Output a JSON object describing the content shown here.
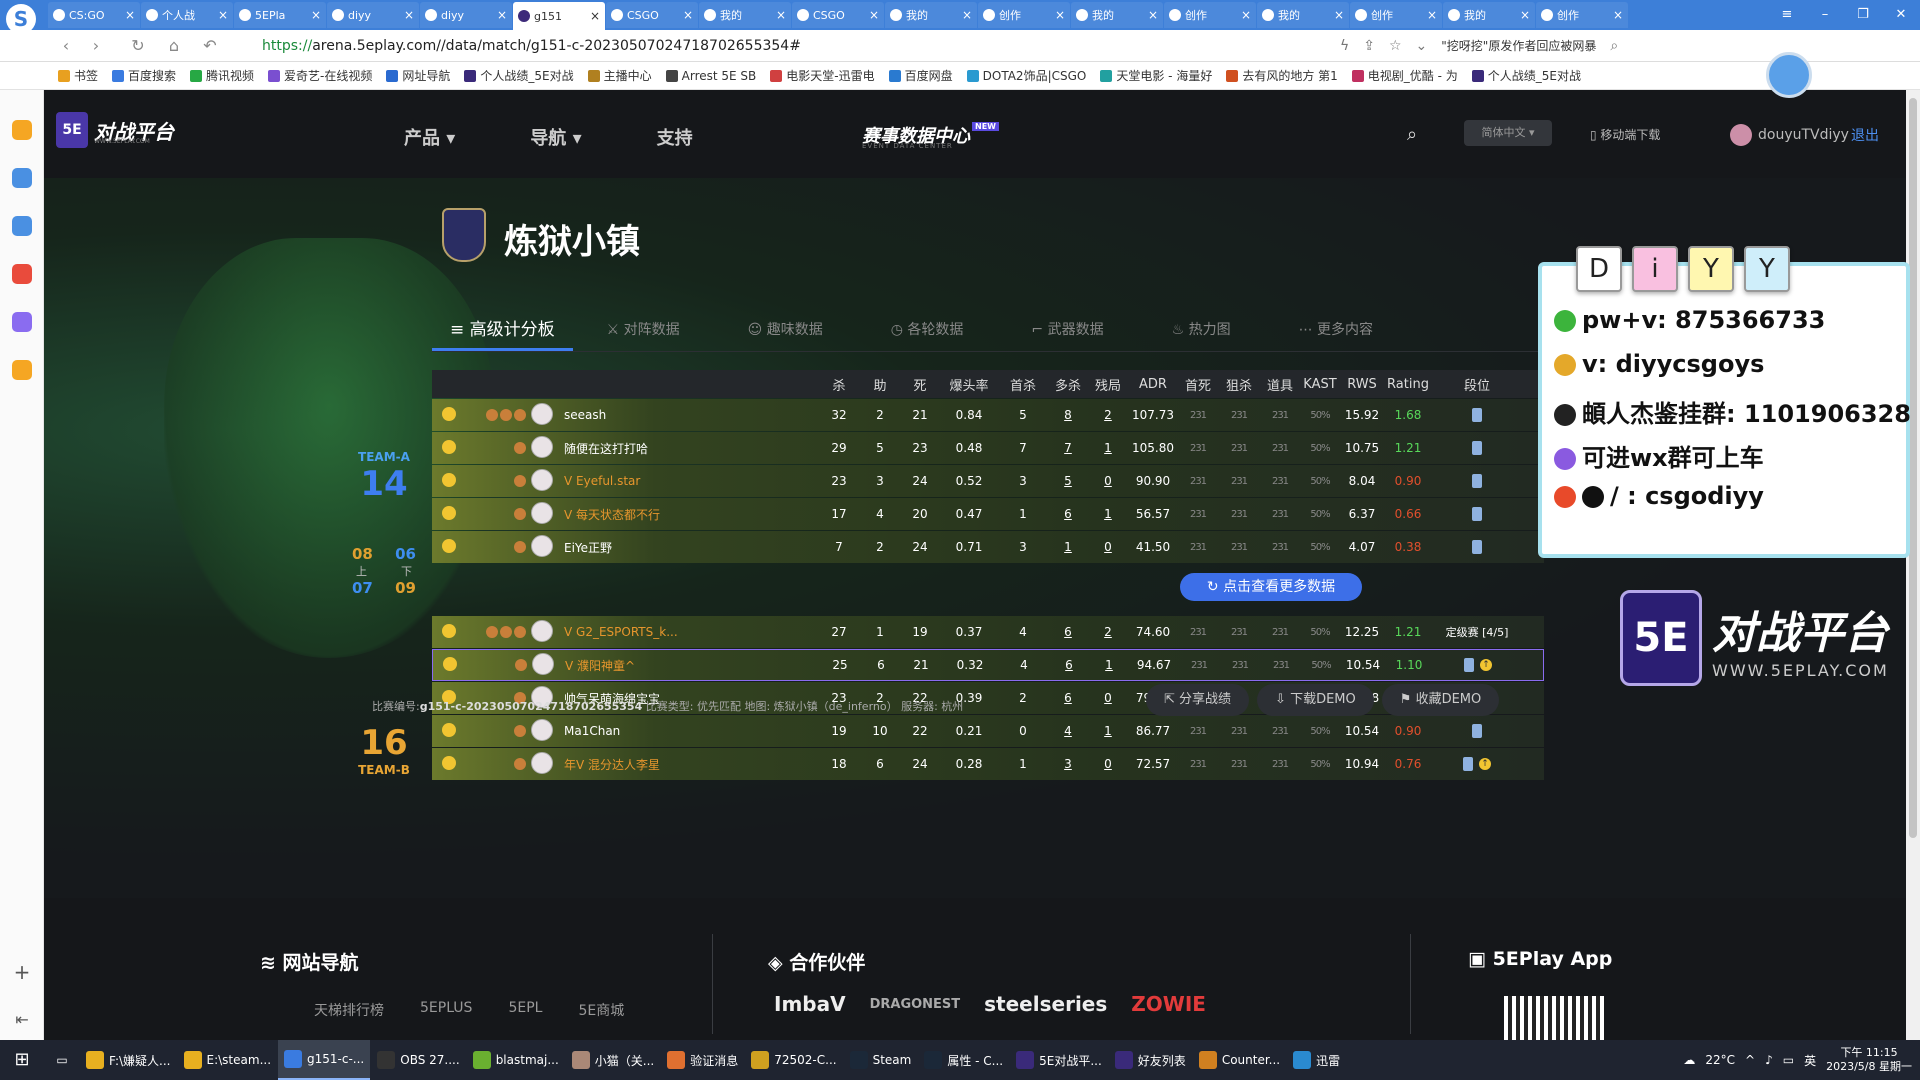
{
  "browser": {
    "tabs": [
      {
        "label": "CS:GO",
        "active": false
      },
      {
        "label": "个人战",
        "active": false
      },
      {
        "label": "5EPla",
        "active": false
      },
      {
        "label": "diyy",
        "active": false
      },
      {
        "label": "diyy",
        "active": false
      },
      {
        "label": "g151",
        "active": true
      },
      {
        "label": "CSGO",
        "active": false
      },
      {
        "label": "我的",
        "active": false
      },
      {
        "label": "CSGO",
        "active": false
      },
      {
        "label": "我的",
        "active": false
      },
      {
        "label": "创作",
        "active": false
      },
      {
        "label": "我的",
        "active": false
      },
      {
        "label": "创作",
        "active": false
      },
      {
        "label": "我的",
        "active": false
      },
      {
        "label": "创作",
        "active": false
      },
      {
        "label": "我的",
        "active": false
      },
      {
        "label": "创作",
        "active": false
      }
    ],
    "url_scheme": "https://",
    "url_rest": "arena.5eplay.com//data/match/g151-c-20230507024718702655354#",
    "search_hint": "\"挖呀挖\"原发作者回应被网暴",
    "bookmarks": [
      "书签",
      "百度搜索",
      "腾讯视频",
      "爱奇艺-在线视频",
      "网址导航",
      "个人战绩_5E对战",
      "主播中心",
      "Arrest 5E SB",
      "电影天堂-迅雷电",
      "百度网盘",
      "DOTA2饰品|CSGO",
      "天堂电影 - 海量好",
      "去有风的地方 第1",
      "电视剧_优酷 - 为",
      "个人战绩_5E对战"
    ]
  },
  "site": {
    "logo_text": "对战平台",
    "logo_badge": "5E",
    "logo_sub": "WWW.5EPLAY.COM",
    "nav": [
      "产品",
      "导航",
      "支持"
    ],
    "event_center": "赛事数据中心",
    "event_new": "NEW",
    "event_sub": "EVENT DATA CENTER",
    "lang": "简体中文",
    "mobile": "移动端下载",
    "username": "douyuTVdiyy",
    "logout": "退出"
  },
  "match": {
    "map_name": "炼狱小镇",
    "tabs": [
      "高级计分板",
      "对阵数据",
      "趣味数据",
      "各轮数据",
      "武器数据",
      "热力图",
      "更多内容"
    ],
    "team_a": {
      "label": "TEAM-A",
      "score": "14"
    },
    "team_b": {
      "label": "TEAM-B",
      "score": "16"
    },
    "halves": {
      "a_first": "08",
      "b_first": "06",
      "a_second": "07",
      "b_second": "09",
      "first_label": "上",
      "second_label": "下"
    },
    "columns": [
      "杀",
      "助",
      "死",
      "爆头率",
      "首杀",
      "多杀",
      "残局",
      "ADR",
      "首死",
      "狙杀",
      "道具",
      "KAST",
      "RWS",
      "Rating",
      "段位"
    ],
    "blurred": "231",
    "blurred_kast": "50%",
    "team_a_players": [
      {
        "name": "seeash",
        "k": "32",
        "a": "2",
        "d": "21",
        "hs": "0.84",
        "fk": "5",
        "mk": "8",
        "cl": "2",
        "adr": "107.73",
        "rws": "15.92",
        "rating": "1.68",
        "good": true,
        "orange": false
      },
      {
        "name": "随便在这打打哈",
        "k": "29",
        "a": "5",
        "d": "23",
        "hs": "0.48",
        "fk": "7",
        "mk": "7",
        "cl": "1",
        "adr": "105.80",
        "rws": "10.75",
        "rating": "1.21",
        "good": true,
        "orange": false
      },
      {
        "name": "V Eyeful.star",
        "k": "23",
        "a": "3",
        "d": "24",
        "hs": "0.52",
        "fk": "3",
        "mk": "5",
        "cl": "0",
        "adr": "90.90",
        "rws": "8.04",
        "rating": "0.90",
        "good": false,
        "orange": true
      },
      {
        "name": "V 每天状态都不行",
        "k": "17",
        "a": "4",
        "d": "20",
        "hs": "0.47",
        "fk": "1",
        "mk": "6",
        "cl": "1",
        "adr": "56.57",
        "rws": "6.37",
        "rating": "0.66",
        "good": false,
        "orange": true
      },
      {
        "name": "EiYe正野",
        "k": "7",
        "a": "2",
        "d": "24",
        "hs": "0.71",
        "fk": "3",
        "mk": "1",
        "cl": "0",
        "adr": "41.50",
        "rws": "4.07",
        "rating": "0.38",
        "good": false,
        "orange": false
      }
    ],
    "team_b_players": [
      {
        "name": "V G2_ESPORTS_k...",
        "k": "27",
        "a": "1",
        "d": "19",
        "hs": "0.37",
        "fk": "4",
        "mk": "6",
        "cl": "2",
        "adr": "74.60",
        "rws": "12.25",
        "rating": "1.21",
        "good": true,
        "orange": true,
        "rank": "定级赛 [4/5]"
      },
      {
        "name": "V 濮阳神童^",
        "k": "25",
        "a": "6",
        "d": "21",
        "hs": "0.32",
        "fk": "4",
        "mk": "6",
        "cl": "1",
        "adr": "94.67",
        "rws": "10.54",
        "rating": "1.10",
        "good": true,
        "orange": true,
        "rank": ""
      },
      {
        "name": "帅气呆萌海绵宝宝",
        "k": "23",
        "a": "2",
        "d": "22",
        "hs": "0.39",
        "fk": "2",
        "mk": "6",
        "cl": "0",
        "adr": "79.67",
        "rws": "10.58",
        "rating": "1.01",
        "good": true,
        "orange": false,
        "rank": ""
      },
      {
        "name": "Ma1Chan",
        "k": "19",
        "a": "10",
        "d": "22",
        "hs": "0.21",
        "fk": "0",
        "mk": "4",
        "cl": "1",
        "adr": "86.77",
        "rws": "10.54",
        "rating": "0.90",
        "good": false,
        "orange": false,
        "rank": ""
      },
      {
        "name": "年V 混分达人李星",
        "k": "18",
        "a": "6",
        "d": "24",
        "hs": "0.28",
        "fk": "1",
        "mk": "3",
        "cl": "0",
        "adr": "72.57",
        "rws": "10.94",
        "rating": "0.76",
        "good": false,
        "orange": true,
        "rank": ""
      }
    ],
    "more_button": "点击查看更多数据",
    "info_prefix": "比赛编号:",
    "match_id": "g151-c-20230507024718702655354",
    "info_rest": "比赛类型: 优先匹配 地图: 炼狱小镇（de_inferno） 服务器: 杭州",
    "actions": [
      "分享战绩",
      "下载DEMO",
      "收藏DEMO"
    ]
  },
  "footer": {
    "nav_title": "网站导航",
    "partner_title": "合作伙伴",
    "app_title": "5EPlay App",
    "nav_links": [
      "天梯排行榜",
      "5EPLUS",
      "5EPL",
      "5E商城"
    ],
    "partners": [
      "ImbaV",
      "DRAGONEST",
      "steelseries",
      "ZOWIE"
    ]
  },
  "overlay": {
    "cards": [
      "D",
      "i",
      "Y",
      "Y"
    ],
    "line1": "pw+v: 875366733",
    "line2": "v: diyycsgoys",
    "line3": "頔人杰鉴挂群: 1101906328",
    "line4": "可进wx群可上车",
    "line5": "/ : csgodiyy",
    "brand_top": "对战平台",
    "brand_bottom": "WWW.5EPLAY.COM",
    "brand_badge": "5E"
  },
  "taskbar": {
    "items": [
      "F:\\嫌疑人...",
      "E:\\steam...",
      "g151-c-...",
      "OBS 27....",
      "blastmaj...",
      "小猫（关...",
      "验证消息",
      "72502-C...",
      "Steam",
      "属性 - C...",
      "5E对战平...",
      "好友列表",
      "Counter...",
      "迅雷"
    ],
    "active_index": 2,
    "weather": "22°C",
    "ime": "英",
    "time": "下午 11:15",
    "date": "2023/5/8 星期一"
  }
}
